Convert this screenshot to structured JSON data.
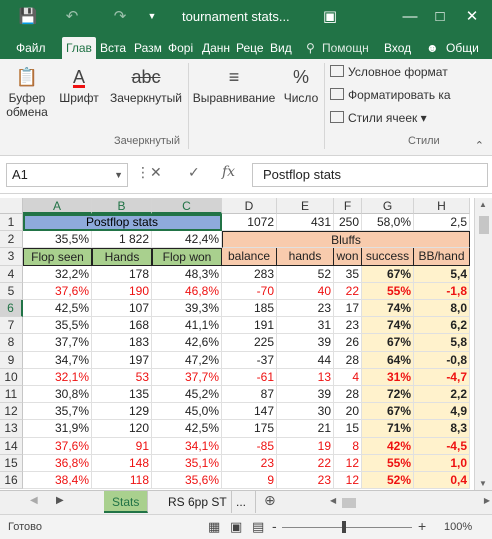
{
  "window": {
    "title": "tournament stats..."
  },
  "titlebar_icons": [
    "save-icon",
    "undo-icon",
    "redo-icon",
    "customize-qat-icon",
    "ribbon-options-icon",
    "minimize-icon",
    "maximize-icon",
    "close-icon"
  ],
  "tabs": [
    "Файл",
    "Глав",
    "Вста",
    "Разм",
    "Форі",
    "Данн",
    "Реце",
    "Вид"
  ],
  "tab_active": "Глав",
  "tell_me": "Помощн",
  "signin": "Вход",
  "share": "Общи",
  "ribbon": {
    "clipboard": {
      "line1": "Буфер",
      "line2": "обмена"
    },
    "font": "Шрифт",
    "strike": "Зачеркнутый",
    "strike_group": "Зачеркнутый",
    "align": "Выравнивание",
    "number": "Число",
    "cond": "Условное формат",
    "format_table": "Форматировать ка",
    "cell_styles": "Стили ячеек",
    "styles_group": "Стили",
    "icon_abc": "abc"
  },
  "formula_bar": {
    "namebox": "A1",
    "value": "Postflop stats",
    "fx": "fx"
  },
  "columns": [
    "A",
    "B",
    "C",
    "D",
    "E",
    "F",
    "G",
    "H"
  ],
  "rows": [
    "1",
    "2",
    "3",
    "4",
    "5",
    "6",
    "7",
    "8",
    "9",
    "10",
    "11",
    "12",
    "13",
    "14",
    "15",
    "16"
  ],
  "cells": {
    "r1": {
      "a": "Postflop stats",
      "d": "1072",
      "e": "431",
      "f": "250",
      "g": "58,0%",
      "h": "2,5"
    },
    "r2": {
      "a": "35,5%",
      "b": "1 822",
      "c": "42,4%",
      "bluffs": "Bluffs"
    },
    "r3": [
      "Flop seen",
      "Hands",
      "Flop won",
      "balance",
      "hands",
      "won",
      "success",
      "BB/hand"
    ]
  },
  "table_rows": [
    [
      "32,2%",
      "178",
      "48,3%",
      "283",
      "52",
      "35",
      "67%",
      "5,4"
    ],
    [
      "37,6%",
      "190",
      "46,8%",
      "-70",
      "40",
      "22",
      "55%",
      "-1,8"
    ],
    [
      "42,5%",
      "107",
      "39,3%",
      "185",
      "23",
      "17",
      "74%",
      "8,0"
    ],
    [
      "35,5%",
      "168",
      "41,1%",
      "191",
      "31",
      "23",
      "74%",
      "6,2"
    ],
    [
      "37,7%",
      "183",
      "42,6%",
      "225",
      "39",
      "26",
      "67%",
      "5,8"
    ],
    [
      "34,7%",
      "197",
      "47,2%",
      "-37",
      "44",
      "28",
      "64%",
      "-0,8"
    ],
    [
      "32,1%",
      "53",
      "37,7%",
      "-61",
      "13",
      "4",
      "31%",
      "-4,7"
    ],
    [
      "30,8%",
      "135",
      "45,2%",
      "87",
      "39",
      "28",
      "72%",
      "2,2"
    ],
    [
      "35,7%",
      "129",
      "45,0%",
      "147",
      "30",
      "20",
      "67%",
      "4,9"
    ],
    [
      "31,9%",
      "120",
      "42,5%",
      "175",
      "21",
      "15",
      "71%",
      "8,3"
    ],
    [
      "37,6%",
      "91",
      "34,1%",
      "-85",
      "19",
      "8",
      "42%",
      "-4,5"
    ],
    [
      "36,8%",
      "148",
      "35,1%",
      "23",
      "22",
      "12",
      "55%",
      "1,0"
    ],
    [
      "38,4%",
      "118",
      "35,6%",
      "9",
      "23",
      "12",
      "52%",
      "0,4"
    ]
  ],
  "red_rows": [
    1,
    6,
    10,
    11,
    12
  ],
  "sheets": {
    "active": "Stats",
    "other": "RS 6pp ST",
    "more": "..."
  },
  "status": {
    "ready": "Готово",
    "zoom": "100%",
    "minus": "-",
    "plus": "+"
  },
  "colors": {
    "excel_green": "#217346",
    "header_green": "#a9d08e",
    "bluff_peach": "#f8cbad",
    "light_yellow": "#fff2cc",
    "negative_red": "#ee1111"
  }
}
